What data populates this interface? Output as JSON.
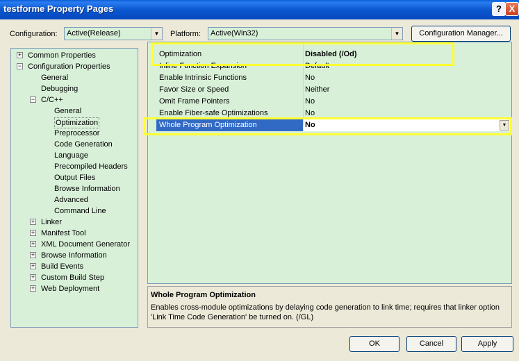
{
  "window": {
    "title": "testforme Property Pages",
    "help_label": "?",
    "close_label": "X"
  },
  "toolbar": {
    "configuration_label": "Configuration:",
    "configuration_value": "Active(Release)",
    "platform_label": "Platform:",
    "platform_value": "Active(Win32)",
    "config_manager_label": "Configuration Manager..."
  },
  "tree": {
    "items": [
      {
        "label": "Common Properties",
        "expander": "+"
      },
      {
        "label": "Configuration Properties",
        "expander": "−"
      },
      {
        "label": "General"
      },
      {
        "label": "Debugging"
      },
      {
        "label": "C/C++",
        "expander": "−"
      },
      {
        "label": "General"
      },
      {
        "label": "Optimization",
        "selected": true
      },
      {
        "label": "Preprocessor"
      },
      {
        "label": "Code Generation"
      },
      {
        "label": "Language"
      },
      {
        "label": "Precompiled Headers"
      },
      {
        "label": "Output Files"
      },
      {
        "label": "Browse Information"
      },
      {
        "label": "Advanced"
      },
      {
        "label": "Command Line"
      },
      {
        "label": "Linker",
        "expander": "+"
      },
      {
        "label": "Manifest Tool",
        "expander": "+"
      },
      {
        "label": "XML Document Generator",
        "expander": "+"
      },
      {
        "label": "Browse Information",
        "expander": "+"
      },
      {
        "label": "Build Events",
        "expander": "+"
      },
      {
        "label": "Custom Build Step",
        "expander": "+"
      },
      {
        "label": "Web Deployment",
        "expander": "+"
      }
    ]
  },
  "grid": {
    "rows": [
      {
        "name": "Optimization",
        "value": "Disabled (/Od)",
        "bold": true
      },
      {
        "name": "Inline Function Expansion",
        "value": "Default"
      },
      {
        "name": "Enable Intrinsic Functions",
        "value": "No"
      },
      {
        "name": "Favor Size or Speed",
        "value": "Neither"
      },
      {
        "name": "Omit Frame Pointers",
        "value": "No"
      },
      {
        "name": "Enable Fiber-safe Optimizations",
        "value": "No"
      },
      {
        "name": "Whole Program Optimization",
        "value": "No",
        "selected": true
      }
    ]
  },
  "description": {
    "title": "Whole Program Optimization",
    "text": "Enables cross-module optimizations by delaying code generation to link time; requires that linker option 'Link Time Code Generation' be turned on.     (/GL)"
  },
  "buttons": {
    "ok": "OK",
    "cancel": "Cancel",
    "apply": "Apply"
  },
  "colors": {
    "panel_background": "#d8f0d8",
    "selection": "#316ac5",
    "highlight_box": "#ffff33"
  }
}
